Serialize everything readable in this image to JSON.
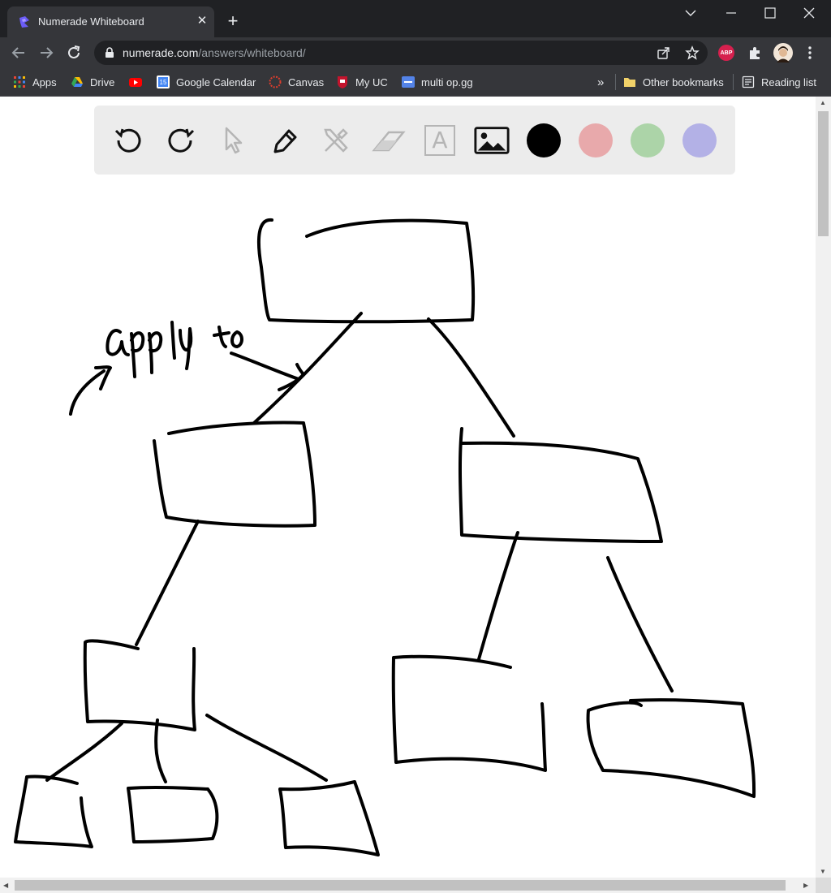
{
  "browser": {
    "tab_title": "Numerade Whiteboard",
    "tab_close": "✕",
    "new_tab": "+",
    "url_host": "numerade.com",
    "url_path": "/answers/whiteboard/",
    "extension_badge": "ABP",
    "bookmarks": [
      {
        "label": "Apps",
        "icon": "apps-grid-icon"
      },
      {
        "label": "Drive",
        "icon": "drive-icon"
      },
      {
        "label": "",
        "icon": "youtube-icon"
      },
      {
        "label": "Google Calendar",
        "icon": "calendar-icon",
        "icon_text": "15"
      },
      {
        "label": "Canvas",
        "icon": "canvas-icon"
      },
      {
        "label": "My UC",
        "icon": "uc-icon"
      },
      {
        "label": "multi op.gg",
        "icon": "opgg-icon"
      }
    ],
    "more_bookmarks": "»",
    "other_bookmarks": "Other bookmarks",
    "reading_list": "Reading list"
  },
  "whiteboard": {
    "tools": [
      "undo",
      "redo",
      "select",
      "pen",
      "shapes",
      "eraser",
      "text",
      "image"
    ],
    "text_tool_glyph": "A",
    "colors": [
      "#000000",
      "#e8a9ab",
      "#acd4a8",
      "#b3b1e6"
    ],
    "handwriting": [
      "apply",
      "to"
    ]
  }
}
